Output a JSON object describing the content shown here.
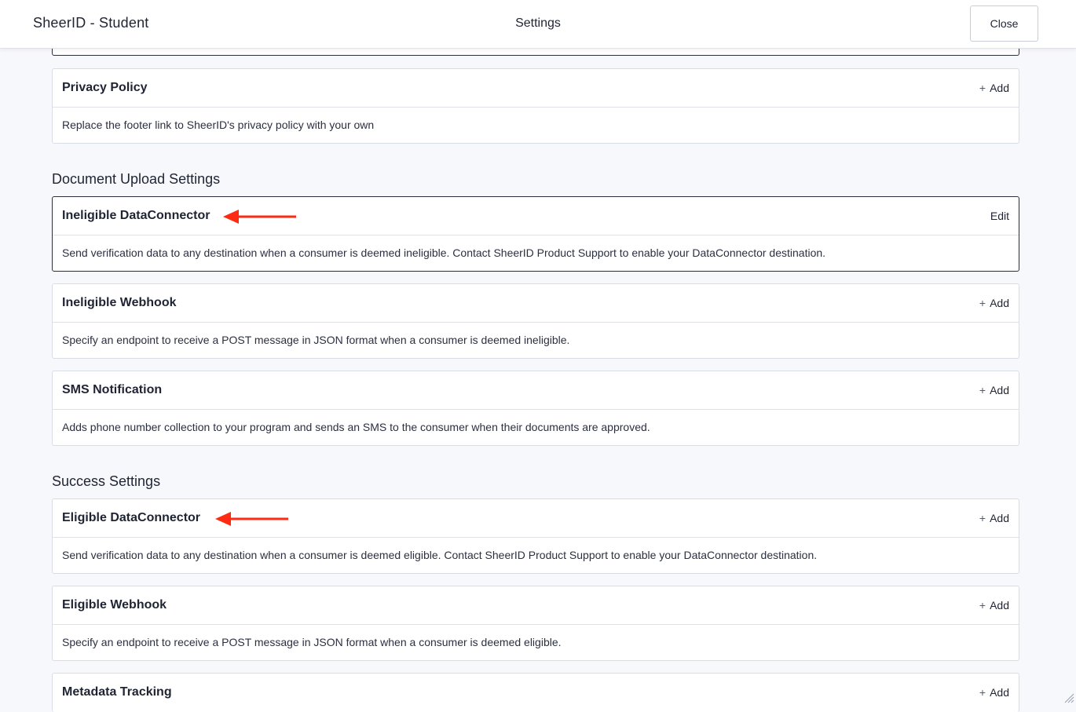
{
  "header": {
    "app_title": "SheerID - Student",
    "page_title": "Settings",
    "close_label": "Close"
  },
  "cards": {
    "privacy_policy": {
      "title": "Privacy Policy",
      "action": "Add",
      "description": "Replace the footer link to SheerID's privacy policy with your own"
    },
    "ineligible_dataconnector": {
      "title": "Ineligible DataConnector",
      "action": "Edit",
      "description": "Send verification data to any destination when a consumer is deemed ineligible. Contact SheerID Product Support to enable your DataConnector destination."
    },
    "ineligible_webhook": {
      "title": "Ineligible Webhook",
      "action": "Add",
      "description": "Specify an endpoint to receive a POST message in JSON format when a consumer is deemed ineligible."
    },
    "sms_notification": {
      "title": "SMS Notification",
      "action": "Add",
      "description": "Adds phone number collection to your program and sends an SMS to the consumer when their documents are approved."
    },
    "eligible_dataconnector": {
      "title": "Eligible DataConnector",
      "action": "Add",
      "description": "Send verification data to any destination when a consumer is deemed eligible. Contact SheerID Product Support to enable your DataConnector destination."
    },
    "eligible_webhook": {
      "title": "Eligible Webhook",
      "action": "Add",
      "description": "Specify an endpoint to receive a POST message in JSON format when a consumer is deemed eligible."
    },
    "metadata_tracking": {
      "title": "Metadata Tracking",
      "action": "Add"
    }
  },
  "sections": {
    "document_upload": "Document Upload Settings",
    "success": "Success Settings"
  },
  "icons": {
    "add": "plus-icon",
    "annotation": "red-arrow-icon",
    "resize": "resize-grip-icon"
  },
  "colors": {
    "annotation_arrow": "#ff2a12",
    "active_border": "#2a2f3a",
    "background": "#f7f8fc"
  }
}
